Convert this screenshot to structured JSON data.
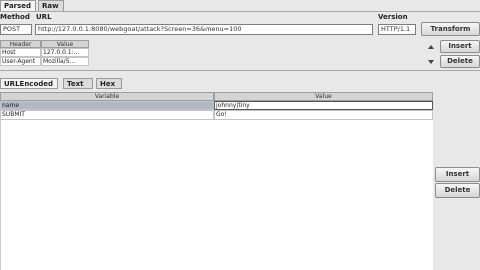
{
  "tabs": [
    {
      "label": "Parsed"
    },
    {
      "label": "Raw"
    }
  ],
  "request": {
    "method_label": "Method",
    "url_label": "URL",
    "version_label": "Version",
    "method_value": "POST",
    "url_value": "http://127.0.0.1:8080/webgoat/attack?Screen=36&menu=100",
    "version_value": "HTTP/1.1",
    "transform_label": "Transform"
  },
  "headers_table": {
    "columns": [
      "Header",
      "Value"
    ],
    "rows": [
      {
        "name": "Host",
        "value": "127.0.0.1:..."
      },
      {
        "name": "User-Agent",
        "value": "Mozilla/5..."
      }
    ],
    "insert_label": "Insert",
    "delete_label": "Delete"
  },
  "body_tabs": [
    {
      "label": "URLEncoded"
    },
    {
      "label": "Text"
    },
    {
      "label": "Hex"
    }
  ],
  "params_table": {
    "columns": [
      "Variable",
      "Value"
    ],
    "rows": [
      {
        "name": "name",
        "value": "johnny|tiny"
      },
      {
        "name": "SUBMIT",
        "value": "Go!"
      }
    ],
    "insert_label": "Insert",
    "delete_label": "Delete"
  }
}
